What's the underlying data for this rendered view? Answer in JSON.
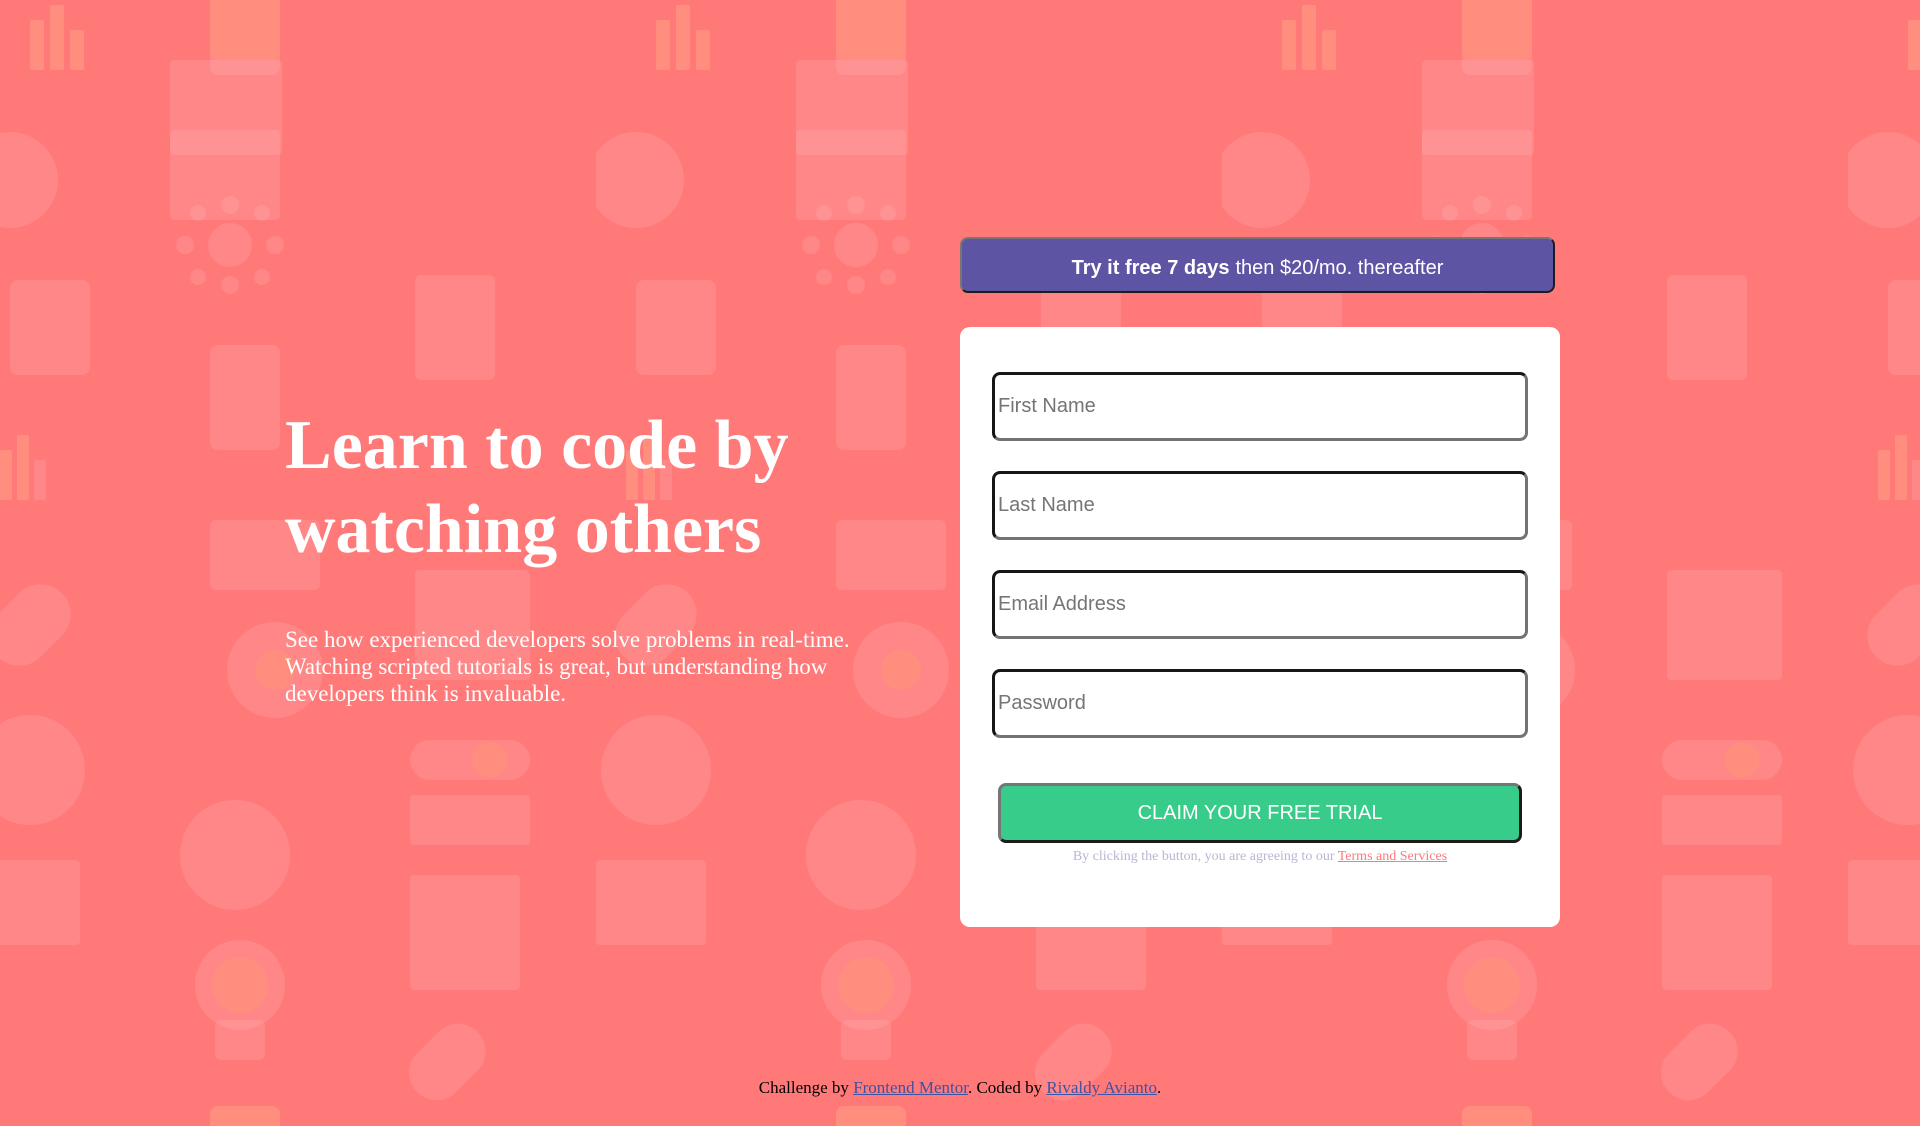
{
  "colors": {
    "background": "#ff7979",
    "promo": "#5e54a4",
    "cta": "#38cc8b",
    "card": "#ffffff",
    "terms_text": "#b9b6d3",
    "terms_link": "#ff7979",
    "footer_link": "#3e52a3"
  },
  "background_icons": [
    "bar-chart-icon",
    "tablet-icon",
    "browser-window-icon",
    "headset-icon",
    "gift-box-icon",
    "network-icon",
    "thumbs-up-icon",
    "refresh-icon",
    "line-chart-icon",
    "chat-bubble-icon",
    "rocket-icon",
    "gear-icon",
    "key-icon",
    "lifebuoy-icon",
    "calendar-icon",
    "lightbulb-icon",
    "magnifier-icon"
  ],
  "hero": {
    "title": "Learn to code by watching others",
    "description": "See how experienced developers solve problems in real-time. Watching scripted tutorials is great, but understanding how developers think is invaluable."
  },
  "promo": {
    "bold_text": "Try it free 7 days",
    "rest_text": "then $20/mo. thereafter"
  },
  "form": {
    "fields": [
      {
        "placeholder": "First Name",
        "value": ""
      },
      {
        "placeholder": "Last Name",
        "value": ""
      },
      {
        "placeholder": "Email Address",
        "value": ""
      },
      {
        "placeholder": "Password",
        "value": ""
      }
    ],
    "submit_label": "CLAIM YOUR FREE TRIAL",
    "terms_prefix": "By clicking the button, you are agreeing to our",
    "terms_link": "Terms and Services"
  },
  "footer": {
    "challenge_prefix": "Challenge by",
    "challenge_link": "Frontend Mentor",
    "coded_prefix": ". Coded by",
    "coded_link": "Rivaldy Avianto",
    "suffix": "."
  }
}
